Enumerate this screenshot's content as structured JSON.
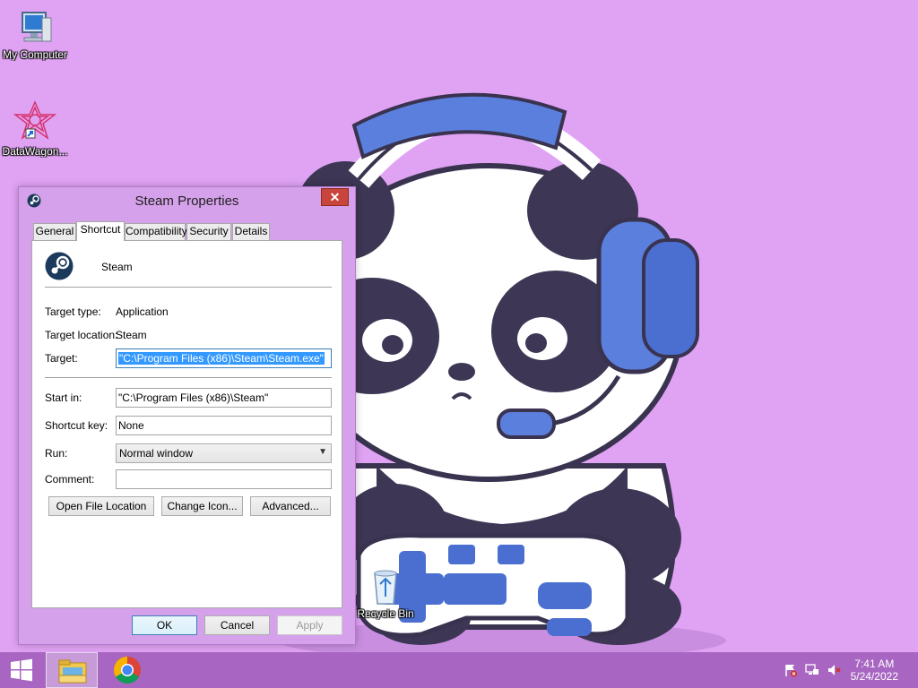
{
  "desktop": {
    "icons": [
      {
        "label": "My Computer",
        "icon": "computer-icon"
      },
      {
        "label": "DataWagon...",
        "icon": "datawagon-icon"
      },
      {
        "label": "Recycle Bin",
        "icon": "recycle-bin-icon"
      }
    ]
  },
  "dialog": {
    "title": "Steam Properties",
    "close_label": "✕",
    "tabs": [
      {
        "label": "General",
        "active": false
      },
      {
        "label": "Shortcut",
        "active": true
      },
      {
        "label": "Compatibility",
        "active": false
      },
      {
        "label": "Security",
        "active": false
      },
      {
        "label": "Details",
        "active": false
      }
    ],
    "shortcut_name": "Steam",
    "target_type_label": "Target type:",
    "target_type_value": "Application",
    "target_location_label": "Target location:",
    "target_location_value": "Steam",
    "target_label": "Target:",
    "target_value": "\"C:\\Program Files (x86)\\Steam\\Steam.exe\"",
    "start_in_label": "Start in:",
    "start_in_value": "\"C:\\Program Files (x86)\\Steam\"",
    "shortcut_key_label": "Shortcut key:",
    "shortcut_key_value": "None",
    "run_label": "Run:",
    "run_value": "Normal window",
    "comment_label": "Comment:",
    "comment_value": "",
    "open_file_location_label": "Open File Location",
    "change_icon_label": "Change Icon...",
    "advanced_label": "Advanced...",
    "ok_label": "OK",
    "cancel_label": "Cancel",
    "apply_label": "Apply"
  },
  "taskbar": {
    "items": [
      {
        "icon": "start-icon"
      },
      {
        "icon": "file-explorer-icon",
        "active": true
      },
      {
        "icon": "chrome-icon",
        "active": false
      }
    ],
    "tray": [
      "action-center-flag-icon",
      "network-icon",
      "volume-muted-icon"
    ],
    "time": "7:41 AM",
    "date": "5/24/2022"
  }
}
